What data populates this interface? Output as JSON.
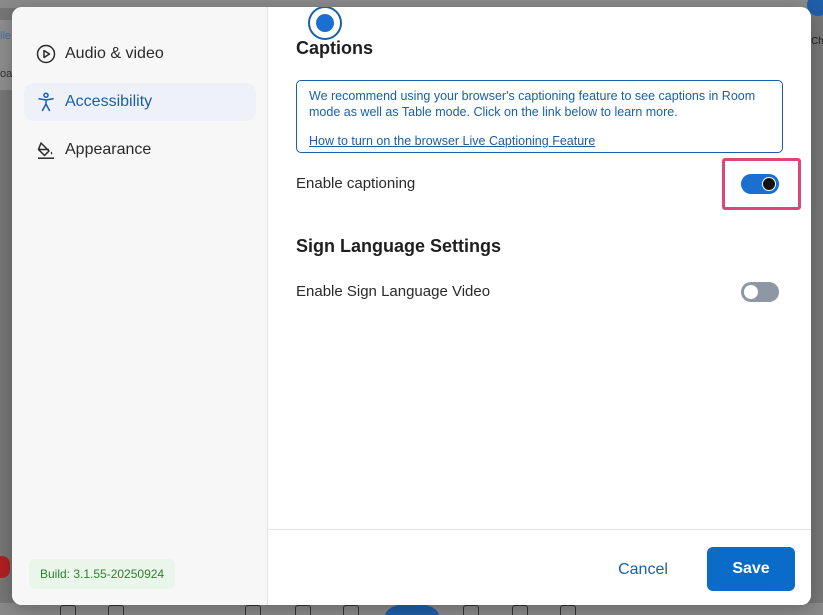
{
  "background": {
    "left_text_top": "lle",
    "left_text_bottom": "oar",
    "right_text": "Ch"
  },
  "sidebar": {
    "items": [
      {
        "label": "Audio & video",
        "icon": "play-circle-icon",
        "active": false
      },
      {
        "label": "Accessibility",
        "icon": "accessibility-icon",
        "active": true
      },
      {
        "label": "Appearance",
        "icon": "paint-bucket-icon",
        "active": false
      }
    ],
    "build": "Build: 3.1.55-20250924"
  },
  "captions": {
    "title": "Captions",
    "info_text": "We recommend using your browser's captioning feature to see captions in Room mode as well as Table mode. Click on the link below to learn more.",
    "info_link": "How to turn on the browser Live Captioning Feature",
    "enable_label": "Enable captioning",
    "enabled": true
  },
  "sign_language": {
    "title": "Sign Language Settings",
    "enable_label": "Enable Sign Language Video",
    "enabled": false
  },
  "footer": {
    "cancel_label": "Cancel",
    "save_label": "Save"
  },
  "colors": {
    "accent": "#1a5fa8",
    "save_button": "#0b6bc9",
    "highlight": "#e0457a",
    "build_badge_text": "#2e7d32"
  }
}
